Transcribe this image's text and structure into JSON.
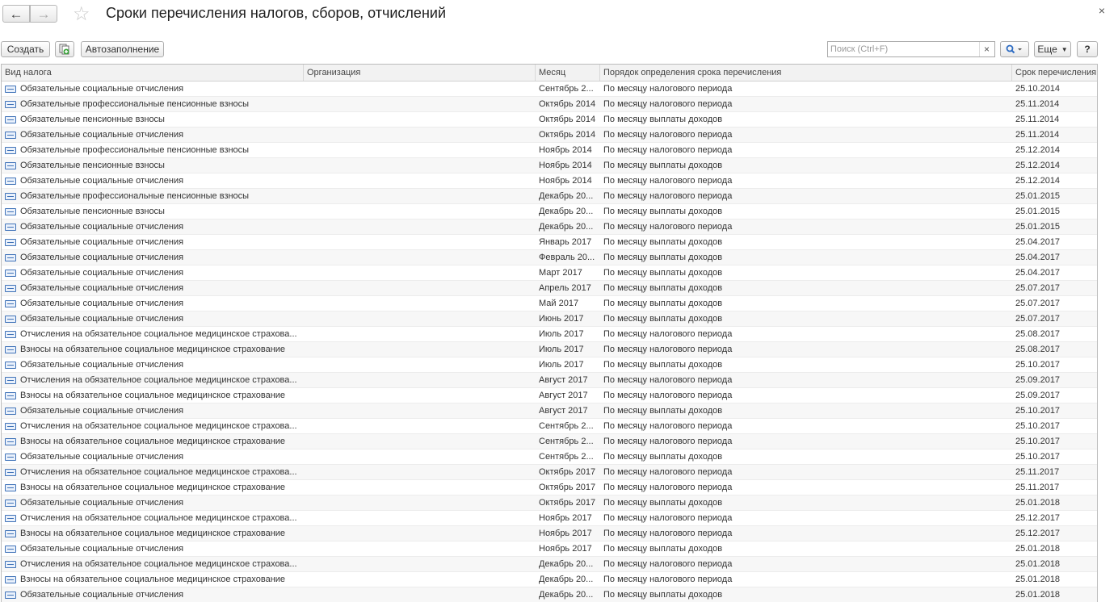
{
  "window": {
    "title": "Сроки перечисления налогов, сборов, отчислений",
    "back_icon": "arrow-left-icon",
    "forward_icon": "arrow-right-icon",
    "favorite_icon": "star-icon",
    "close_icon": "close-icon",
    "close_glyph": "×"
  },
  "toolbar": {
    "create_label": "Создать",
    "copy_icon": "copy-add-icon",
    "autofill_label": "Автозаполнение",
    "search_placeholder": "Поиск (Ctrl+F)",
    "search_clear": "×",
    "search_icon": "magnifier-icon",
    "more_label": "Еще",
    "help_label": "?"
  },
  "table": {
    "columns": [
      "Вид налога",
      "Организация",
      "Месяц",
      "Порядок определения срока перечисления",
      "Срок перечисления"
    ],
    "rows": [
      [
        "Обязательные социальные отчисления",
        "",
        "Сентябрь 2...",
        "По месяцу налогового периода",
        "25.10.2014"
      ],
      [
        "Обязательные профессиональные пенсионные взносы",
        "",
        "Октябрь 2014",
        "По месяцу налогового периода",
        "25.11.2014"
      ],
      [
        "Обязательные пенсионные взносы",
        "",
        "Октябрь 2014",
        "По месяцу выплаты доходов",
        "25.11.2014"
      ],
      [
        "Обязательные социальные отчисления",
        "",
        "Октябрь 2014",
        "По месяцу налогового периода",
        "25.11.2014"
      ],
      [
        "Обязательные профессиональные пенсионные взносы",
        "",
        "Ноябрь 2014",
        "По месяцу налогового периода",
        "25.12.2014"
      ],
      [
        "Обязательные пенсионные взносы",
        "",
        "Ноябрь 2014",
        "По месяцу выплаты доходов",
        "25.12.2014"
      ],
      [
        "Обязательные социальные отчисления",
        "",
        "Ноябрь 2014",
        "По месяцу налогового периода",
        "25.12.2014"
      ],
      [
        "Обязательные профессиональные пенсионные взносы",
        "",
        "Декабрь 20...",
        "По месяцу налогового периода",
        "25.01.2015"
      ],
      [
        "Обязательные пенсионные взносы",
        "",
        "Декабрь 20...",
        "По месяцу выплаты доходов",
        "25.01.2015"
      ],
      [
        "Обязательные социальные отчисления",
        "",
        "Декабрь 20...",
        "По месяцу налогового периода",
        "25.01.2015"
      ],
      [
        "Обязательные социальные отчисления",
        "",
        "Январь 2017",
        "По месяцу выплаты доходов",
        "25.04.2017"
      ],
      [
        "Обязательные социальные отчисления",
        "",
        "Февраль 20...",
        "По месяцу выплаты доходов",
        "25.04.2017"
      ],
      [
        "Обязательные социальные отчисления",
        "",
        "Март 2017",
        "По месяцу выплаты доходов",
        "25.04.2017"
      ],
      [
        "Обязательные социальные отчисления",
        "",
        "Апрель 2017",
        "По месяцу выплаты доходов",
        "25.07.2017"
      ],
      [
        "Обязательные социальные отчисления",
        "",
        "Май 2017",
        "По месяцу выплаты доходов",
        "25.07.2017"
      ],
      [
        "Обязательные социальные отчисления",
        "",
        "Июнь 2017",
        "По месяцу выплаты доходов",
        "25.07.2017"
      ],
      [
        "Отчисления на обязательное социальное медицинское страхова...",
        "",
        "Июль 2017",
        "По месяцу налогового периода",
        "25.08.2017"
      ],
      [
        "Взносы на обязательное социальное медицинское страхование",
        "",
        "Июль 2017",
        "По месяцу налогового периода",
        "25.08.2017"
      ],
      [
        "Обязательные социальные отчисления",
        "",
        "Июль 2017",
        "По месяцу выплаты доходов",
        "25.10.2017"
      ],
      [
        "Отчисления на обязательное социальное медицинское страхова...",
        "",
        "Август 2017",
        "По месяцу налогового периода",
        "25.09.2017"
      ],
      [
        "Взносы на обязательное социальное медицинское страхование",
        "",
        "Август 2017",
        "По месяцу налогового периода",
        "25.09.2017"
      ],
      [
        "Обязательные социальные отчисления",
        "",
        "Август 2017",
        "По месяцу выплаты доходов",
        "25.10.2017"
      ],
      [
        "Отчисления на обязательное социальное медицинское страхова...",
        "",
        "Сентябрь 2...",
        "По месяцу налогового периода",
        "25.10.2017"
      ],
      [
        "Взносы на обязательное социальное медицинское страхование",
        "",
        "Сентябрь 2...",
        "По месяцу налогового периода",
        "25.10.2017"
      ],
      [
        "Обязательные социальные отчисления",
        "",
        "Сентябрь 2...",
        "По месяцу выплаты доходов",
        "25.10.2017"
      ],
      [
        "Отчисления на обязательное социальное медицинское страхова...",
        "",
        "Октябрь 2017",
        "По месяцу налогового периода",
        "25.11.2017"
      ],
      [
        "Взносы на обязательное социальное медицинское страхование",
        "",
        "Октябрь 2017",
        "По месяцу налогового периода",
        "25.11.2017"
      ],
      [
        "Обязательные социальные отчисления",
        "",
        "Октябрь 2017",
        "По месяцу выплаты доходов",
        "25.01.2018"
      ],
      [
        "Отчисления на обязательное социальное медицинское страхова...",
        "",
        "Ноябрь 2017",
        "По месяцу налогового периода",
        "25.12.2017"
      ],
      [
        "Взносы на обязательное социальное медицинское страхование",
        "",
        "Ноябрь 2017",
        "По месяцу налогового периода",
        "25.12.2017"
      ],
      [
        "Обязательные социальные отчисления",
        "",
        "Ноябрь 2017",
        "По месяцу выплаты доходов",
        "25.01.2018"
      ],
      [
        "Отчисления на обязательное социальное медицинское страхова...",
        "",
        "Декабрь 20...",
        "По месяцу налогового периода",
        "25.01.2018"
      ],
      [
        "Взносы на обязательное социальное медицинское страхование",
        "",
        "Декабрь 20...",
        "По месяцу налогового периода",
        "25.01.2018"
      ],
      [
        "Обязательные социальные отчисления",
        "",
        "Декабрь 20...",
        "По месяцу выплаты доходов",
        "25.01.2018"
      ]
    ],
    "row_icon": "record-icon"
  }
}
